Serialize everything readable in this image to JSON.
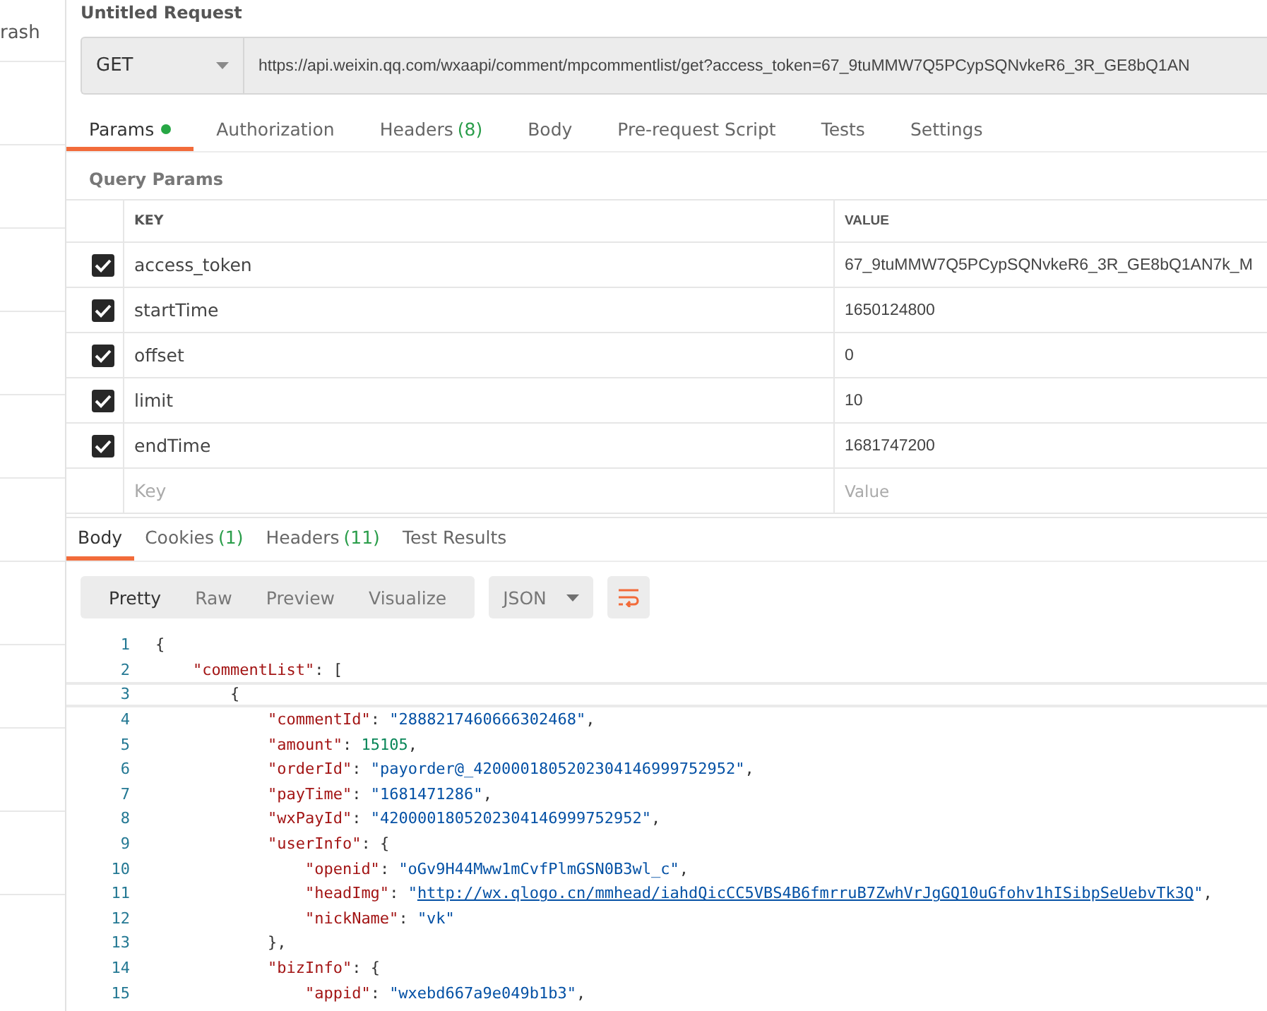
{
  "sidebar": {
    "items": [
      {
        "label": "rash"
      }
    ]
  },
  "request": {
    "title": "Untitled Request",
    "method": "GET",
    "url": "https://api.weixin.qq.com/wxaapi/comment/mpcommentlist/get?access_token=67_9tuMMW7Q5PCypSQNvkeR6_3R_GE8bQ1AN"
  },
  "request_tabs": [
    {
      "label": "Params",
      "dot": true,
      "selected": true
    },
    {
      "label": "Authorization",
      "dot": false,
      "selected": false
    },
    {
      "label": "Headers",
      "count": "(8)",
      "dot": false,
      "selected": false
    },
    {
      "label": "Body",
      "dot": false,
      "selected": false
    },
    {
      "label": "Pre-request Script",
      "dot": false,
      "selected": false
    },
    {
      "label": "Tests",
      "dot": false,
      "selected": false
    },
    {
      "label": "Settings",
      "dot": false,
      "selected": false
    }
  ],
  "query_params": {
    "heading": "Query Params",
    "columns": [
      "KEY",
      "VALUE"
    ],
    "rows": [
      {
        "key": "access_token",
        "value": "67_9tuMMW7Q5PCypSQNvkeR6_3R_GE8bQ1AN7k_M",
        "checked": true
      },
      {
        "key": "startTime",
        "value": "1650124800",
        "checked": true
      },
      {
        "key": "offset",
        "value": "0",
        "checked": true
      },
      {
        "key": "limit",
        "value": "10",
        "checked": true
      },
      {
        "key": "endTime",
        "value": "1681747200",
        "checked": true
      }
    ],
    "new_row": {
      "key_placeholder": "Key",
      "value_placeholder": "Value"
    }
  },
  "response_tabs": [
    {
      "label": "Body",
      "selected": true
    },
    {
      "label": "Cookies",
      "count": "(1)",
      "selected": false
    },
    {
      "label": "Headers",
      "count": "(11)",
      "selected": false
    },
    {
      "label": "Test Results",
      "selected": false
    }
  ],
  "view_modes": [
    {
      "label": "Pretty",
      "selected": true
    },
    {
      "label": "Raw",
      "selected": false
    },
    {
      "label": "Preview",
      "selected": false
    },
    {
      "label": "Visualize",
      "selected": false
    }
  ],
  "format": "JSON",
  "code": [
    {
      "number": "1",
      "current": false,
      "tokens": [
        {
          "kind": "punct",
          "text": "{"
        }
      ],
      "children": [
        {
          "number": "2",
          "current": false,
          "tokens": [
            {
              "kind": "key",
              "text": "\"commentList\""
            },
            {
              "kind": "punct",
              "text": ": ["
            }
          ],
          "children": [
            {
              "number": "3",
              "current": true,
              "tokens": [
                {
                  "kind": "punct",
                  "text": "{"
                }
              ],
              "children": [
                {
                  "number": "4",
                  "current": false,
                  "tokens": [
                    {
                      "kind": "key",
                      "text": "\"commentId\""
                    },
                    {
                      "kind": "punct",
                      "text": ": "
                    },
                    {
                      "kind": "string",
                      "text": "\"2888217460666302468\""
                    },
                    {
                      "kind": "punct",
                      "text": ","
                    }
                  ]
                },
                {
                  "number": "5",
                  "current": false,
                  "tokens": [
                    {
                      "kind": "key",
                      "text": "\"amount\""
                    },
                    {
                      "kind": "punct",
                      "text": ": "
                    },
                    {
                      "kind": "number",
                      "text": "15105"
                    },
                    {
                      "kind": "punct",
                      "text": ","
                    }
                  ]
                },
                {
                  "number": "6",
                  "current": false,
                  "tokens": [
                    {
                      "kind": "key",
                      "text": "\"orderId\""
                    },
                    {
                      "kind": "punct",
                      "text": ": "
                    },
                    {
                      "kind": "string",
                      "text": "\"payorder@_4200001805202304146999752952\""
                    },
                    {
                      "kind": "punct",
                      "text": ","
                    }
                  ]
                },
                {
                  "number": "7",
                  "current": false,
                  "tokens": [
                    {
                      "kind": "key",
                      "text": "\"payTime\""
                    },
                    {
                      "kind": "punct",
                      "text": ": "
                    },
                    {
                      "kind": "string",
                      "text": "\"1681471286\""
                    },
                    {
                      "kind": "punct",
                      "text": ","
                    }
                  ]
                },
                {
                  "number": "8",
                  "current": false,
                  "tokens": [
                    {
                      "kind": "key",
                      "text": "\"wxPayId\""
                    },
                    {
                      "kind": "punct",
                      "text": ": "
                    },
                    {
                      "kind": "string",
                      "text": "\"4200001805202304146999752952\""
                    },
                    {
                      "kind": "punct",
                      "text": ","
                    }
                  ]
                },
                {
                  "number": "9",
                  "current": false,
                  "tokens": [
                    {
                      "kind": "key",
                      "text": "\"userInfo\""
                    },
                    {
                      "kind": "punct",
                      "text": ": {"
                    }
                  ],
                  "children": [
                    {
                      "number": "10",
                      "current": false,
                      "tokens": [
                        {
                          "kind": "key",
                          "text": "\"openid\""
                        },
                        {
                          "kind": "punct",
                          "text": ": "
                        },
                        {
                          "kind": "string",
                          "text": "\"oGv9H44Mww1mCvfPlmGSN0B3wl_c\""
                        },
                        {
                          "kind": "punct",
                          "text": ","
                        }
                      ]
                    },
                    {
                      "number": "11",
                      "current": false,
                      "tokens": [
                        {
                          "kind": "key",
                          "text": "\"headImg\""
                        },
                        {
                          "kind": "punct",
                          "text": ": "
                        },
                        {
                          "kind": "string",
                          "text": "\""
                        },
                        {
                          "kind": "link",
                          "text": "http://wx.qlogo.cn/mmhead/iahdQicCC5VBS4B6fmrruB7ZwhVrJgGQ10uGfohv1hISibpSeUebvTk3Q"
                        },
                        {
                          "kind": "string",
                          "text": "\""
                        },
                        {
                          "kind": "punct",
                          "text": ","
                        }
                      ]
                    },
                    {
                      "number": "12",
                      "current": false,
                      "tokens": [
                        {
                          "kind": "key",
                          "text": "\"nickName\""
                        },
                        {
                          "kind": "punct",
                          "text": ": "
                        },
                        {
                          "kind": "string",
                          "text": "\"vk\""
                        }
                      ]
                    }
                  ]
                },
                {
                  "number": "13",
                  "current": false,
                  "tokens": [
                    {
                      "kind": "punct",
                      "text": "},"
                    }
                  ]
                },
                {
                  "number": "14",
                  "current": false,
                  "tokens": [
                    {
                      "kind": "key",
                      "text": "\"bizInfo\""
                    },
                    {
                      "kind": "punct",
                      "text": ": {"
                    }
                  ],
                  "children": [
                    {
                      "number": "15",
                      "current": false,
                      "tokens": [
                        {
                          "kind": "key",
                          "text": "\"appid\""
                        },
                        {
                          "kind": "punct",
                          "text": ": "
                        },
                        {
                          "kind": "string",
                          "text": "\"wxebd667a9e049b1b3\""
                        },
                        {
                          "kind": "punct",
                          "text": ","
                        }
                      ]
                    }
                  ]
                }
              ]
            }
          ]
        }
      ]
    }
  ]
}
